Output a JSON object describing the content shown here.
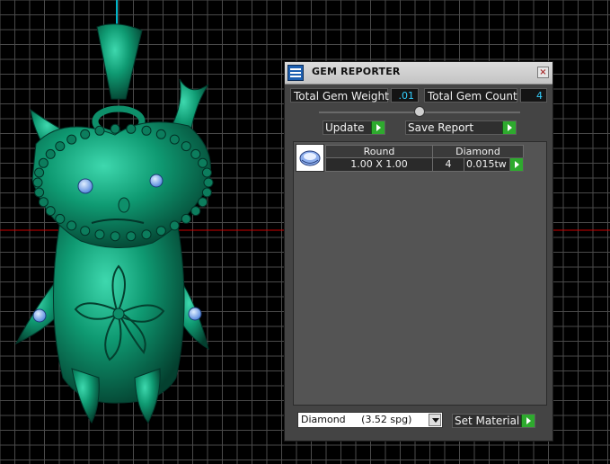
{
  "panel": {
    "title": "GEM REPORTER",
    "close_glyph": "×",
    "total_gem_weight_label": "Total Gem Weight",
    "total_gem_weight_value": ".01",
    "total_gem_count_label": "Total Gem Count",
    "total_gem_count_value": "4",
    "update_label": "Update",
    "save_report_label": "Save Report",
    "table": {
      "headers": [
        "Round",
        "Diamond"
      ],
      "row": {
        "size": "1.00 X 1.00",
        "count": "4",
        "weight": "0.015tw"
      }
    },
    "material_select": "Diamond     (3.52 spg)",
    "set_material_label": "Set Material"
  },
  "icons": {
    "title": "gem-reporter-icon",
    "gem": "round-gem-icon",
    "arrow": "play-arrow-icon"
  },
  "colors": {
    "model": "#0e8f6a",
    "model_highlight": "#38d1a5",
    "gem_stones": "#7fb4ff",
    "grid": "#4a4a4a",
    "axis_red": "#cc0000",
    "axis_cyan": "#00b5c8",
    "button_arrow": "#2eaa2e",
    "value_text": "#33d0ff"
  }
}
